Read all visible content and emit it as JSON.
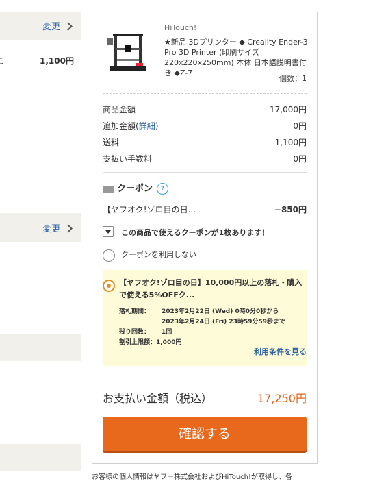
{
  "left": {
    "change_label_1": "変更",
    "cut_char": "こ",
    "shipping_value": "1,100円",
    "change_label_2": "変更"
  },
  "item": {
    "seller": "HiTouch!",
    "title": "★新品 3Dプリンター ◆ Creality Ender-3 Pro 3D Printer (印刷サイズ 220x220x250mm) 本体 日本語説明書付き ◆Z-7",
    "quantity": "個数：1"
  },
  "price_rows": [
    {
      "label": "商品金額",
      "value": "17,000円"
    },
    {
      "label": "追加金額(",
      "link": "詳細",
      "label_suffix": ")",
      "value": "0円"
    },
    {
      "label": "送料",
      "value": "1,100円"
    },
    {
      "label": "支払い手数料",
      "value": "0円"
    }
  ],
  "coupon": {
    "heading": "クーポン",
    "help": "?",
    "applied_name": "【ヤフオク!ゾロ目の日...",
    "applied_value": "−850円",
    "available_text": "この商品で使えるクーポンが1枚あります！",
    "no_coupon_label": "クーポンを利用しない",
    "card": {
      "title": "【ヤフオク!ゾロ目の日】10,000円以上の落札・購入で使える5%OFFク...",
      "period_label": "落札期間：",
      "period_from": "2023年2月22日 (Wed) 0時0分0秒から",
      "period_to": "2023年2月24日 (Fri) 23時59分59秒まで",
      "remaining_label": "残り回数：",
      "remaining_value": "1回",
      "discount_limit": "割引上限額：1,000円",
      "terms_link": "利用条件を見る"
    }
  },
  "total": {
    "label": "お支払い金額（税込）",
    "value": "17,250円"
  },
  "confirm_label": "確認する",
  "footer": "お客様の個人情報はヤフー株式会社およびHiTouch!が取得し、各"
}
